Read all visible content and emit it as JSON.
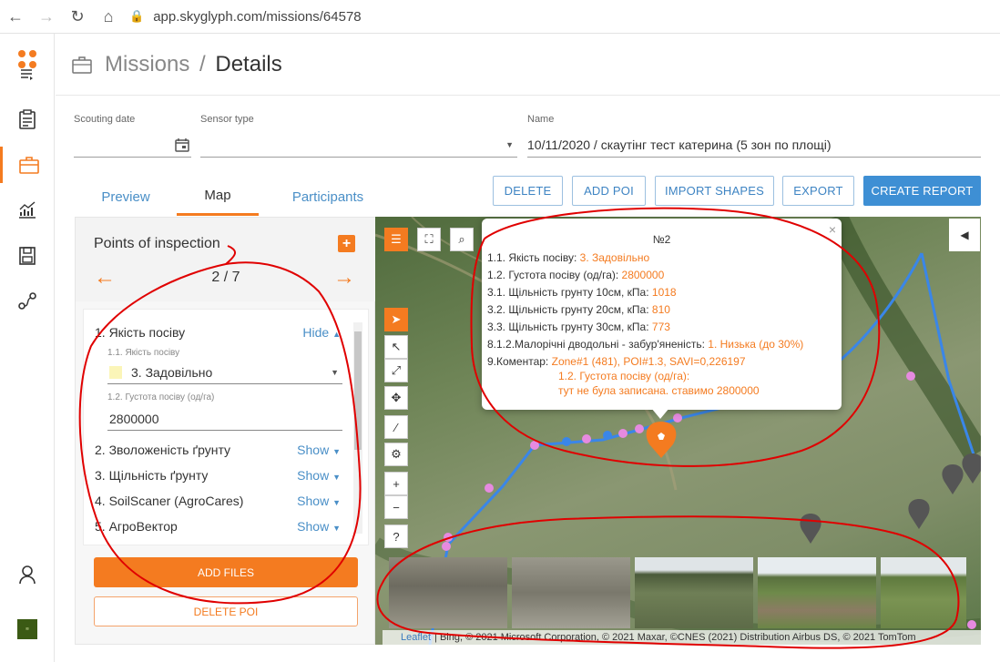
{
  "browser": {
    "url": "app.skyglyph.com/missions/64578"
  },
  "header": {
    "section": "Missions",
    "separator": "/",
    "page": "Details"
  },
  "fields": {
    "scouting_date_label": "Scouting date",
    "scouting_date_value": "",
    "sensor_type_label": "Sensor type",
    "sensor_type_value": "",
    "name_label": "Name",
    "name_value": "10/11/2020 / скаутінг тест катерина (5 зон по площі)"
  },
  "tabs": [
    {
      "label": "Preview",
      "active": false
    },
    {
      "label": "Map",
      "active": true
    },
    {
      "label": "Participants",
      "active": false
    }
  ],
  "actions": {
    "delete": "DELETE",
    "add_poi": "ADD POI",
    "import_shapes": "IMPORT SHAPES",
    "export": "EXPORT",
    "create_report": "CREATE REPORT"
  },
  "poi_panel": {
    "title": "Points of inspection",
    "add_symbol": "+",
    "prev_arrow": "←",
    "next_arrow": "→",
    "counter": "2 / 7",
    "sections": [
      {
        "label": "1. Якість посіву",
        "toggle": "Hide"
      },
      {
        "label": "2. Зволоженість ґрунту",
        "toggle": "Show"
      },
      {
        "label": "3. Щільність ґрунту",
        "toggle": "Show"
      },
      {
        "label": "4. SoilScaner (AgroCares)",
        "toggle": "Show"
      },
      {
        "label": "5. АгроВектор",
        "toggle": "Show"
      }
    ],
    "quality_label": "1.1. Якість посіву",
    "quality_value": "3. Задовільно",
    "quality_color": "#fbf5b8",
    "density_label": "1.2. Густота посіву (од/га)",
    "density_value": "2800000",
    "add_files": "ADD FILES",
    "delete_poi": "DELETE POI"
  },
  "popup": {
    "title": "№2",
    "lines": [
      {
        "label": "1.1. Якість посіву: ",
        "value": "3. Задовільно"
      },
      {
        "label": "1.2. Густота посіву (од/га): ",
        "value": "2800000"
      },
      {
        "label": "3.1. Щільність грунту 10см, кПа: ",
        "value": "1018"
      },
      {
        "label": "3.2. Щільність грунту 20см, кПа: ",
        "value": "810"
      },
      {
        "label": "3.3. Щільність грунту 30см, кПа: ",
        "value": "773"
      },
      {
        "label": "8.1.2.Малорічні дводольні - забур'яненість: ",
        "value": "1. Низька (до 30%)"
      },
      {
        "label": "9.Коментар: ",
        "value": "Zone#1 (481), POI#1.3, SAVI=0,226197"
      }
    ],
    "comment_line2": "1.2. Густота посіву (од/га):",
    "comment_line3": "тут не була записана. ставимо 2800000",
    "close": "×"
  },
  "map": {
    "controls": [
      "sliders-icon",
      "fullscreen-icon",
      "search-icon"
    ],
    "toolbar": [
      "select-arrow-icon",
      "pointer-icon",
      "expand-icon",
      "move-icon",
      "magic-wand-icon",
      "gear-icon",
      "zoom-in-icon",
      "zoom-out-icon",
      "help-icon"
    ],
    "zoom_in": "+",
    "zoom_out": "−",
    "help": "?",
    "attribution_link": "Leaflet",
    "attribution_text": "| Bing, © 2021 Microsoft Corporation, © 2021 Maxar, ©CNES (2021) Distribution Airbus DS, © 2021 TomTom"
  },
  "colors": {
    "accent": "#f47b20",
    "link_blue": "#4a8fc7",
    "primary_button": "#3e8fd4",
    "annotation_red": "#e00000"
  }
}
